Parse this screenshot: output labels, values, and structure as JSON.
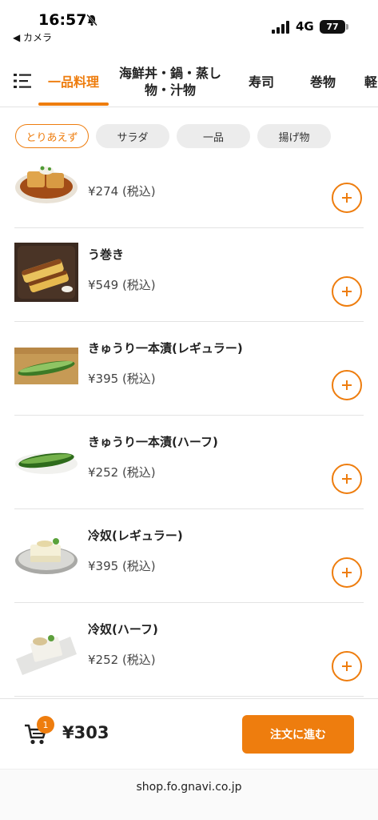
{
  "status_bar": {
    "time": "16:57",
    "back_app": "◀ カメラ",
    "network": "4G",
    "battery": "77"
  },
  "category_tabs": [
    {
      "label": "一品料理",
      "active": true
    },
    {
      "label": "海鮮丼・鍋・蒸し物・汁物",
      "active": false
    },
    {
      "label": "寿司",
      "active": false
    },
    {
      "label": "巻物",
      "active": false
    },
    {
      "label": "軽",
      "active": false
    }
  ],
  "chips": [
    {
      "label": "とりあえず",
      "active": true
    },
    {
      "label": "サラダ",
      "active": false
    },
    {
      "label": "一品",
      "active": false
    },
    {
      "label": "揚げ物",
      "active": false
    }
  ],
  "items": [
    {
      "name": "",
      "price": "¥274 (税込)",
      "image": "agedashi-tofu"
    },
    {
      "name": "う巻き",
      "price": "¥549 (税込)",
      "image": "umaki"
    },
    {
      "name": "きゅうり一本漬(レギュラー)",
      "price": "¥395 (税込)",
      "image": "cucumber"
    },
    {
      "name": "きゅうり一本漬(ハーフ)",
      "price": "¥252 (税込)",
      "image": "cucumber-half"
    },
    {
      "name": "冷奴(レギュラー)",
      "price": "¥395 (税込)",
      "image": "hiyayakko"
    },
    {
      "name": "冷奴(ハーフ)",
      "price": "¥252 (税込)",
      "image": "hiyayakko-half"
    }
  ],
  "cart": {
    "count": "1",
    "total": "¥303",
    "order_label": "注文に進む"
  },
  "url": "shop.fo.gnavi.co.jp",
  "colors": {
    "accent": "#ee7d0e"
  },
  "icons": [
    "bell-slash-icon",
    "signal-icon",
    "menu-list-icon",
    "plus-icon",
    "cart-icon"
  ]
}
